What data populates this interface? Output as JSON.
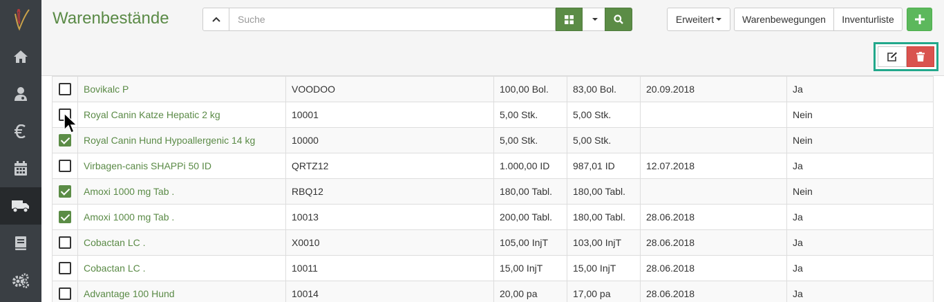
{
  "header": {
    "title": "Warenbestände",
    "search_placeholder": "Suche",
    "erweitert_label": "Erweitert",
    "warenbewegungen_label": "Warenbewegungen",
    "inventurliste_label": "Inventurliste"
  },
  "sidebar": {
    "items": [
      {
        "icon": "home-icon"
      },
      {
        "icon": "user-doctor-icon"
      },
      {
        "icon": "euro-icon"
      },
      {
        "icon": "calendar-icon"
      },
      {
        "icon": "truck-icon",
        "active": true
      },
      {
        "icon": "book-icon"
      },
      {
        "icon": "gears-icon"
      }
    ]
  },
  "colors": {
    "accent_green": "#5b8c46",
    "add_green": "#5cb85c",
    "delete_red": "#d9534f",
    "highlight_teal": "#22a88b",
    "sidebar_bg": "#3a3f44"
  },
  "table": {
    "rows": [
      {
        "checked": false,
        "name": "Bovikalc P",
        "code": "VOODOO",
        "qty1": "100,00 Bol.",
        "qty2": "83,00 Bol.",
        "date": "20.09.2018",
        "flag": "Ja"
      },
      {
        "checked": false,
        "name": "Royal Canin Katze Hepatic 2 kg",
        "code": "10001",
        "qty1": "5,00 Stk.",
        "qty2": "5,00 Stk.",
        "date": "",
        "flag": "Nein"
      },
      {
        "checked": true,
        "name": "Royal Canin Hund Hypoallergenic 14 kg",
        "code": "10000",
        "qty1": "5,00 Stk.",
        "qty2": "5,00 Stk.",
        "date": "",
        "flag": "Nein"
      },
      {
        "checked": false,
        "name": "Virbagen-canis SHAPPi 50 ID",
        "code": "QRTZ12",
        "qty1": "1.000,00 ID",
        "qty2": "987,01 ID",
        "date": "12.07.2018",
        "flag": "Ja"
      },
      {
        "checked": true,
        "name": "Amoxi 1000 mg Tab .",
        "code": "RBQ12",
        "qty1": "180,00 Tabl.",
        "qty2": "180,00 Tabl.",
        "date": "",
        "flag": "Nein"
      },
      {
        "checked": true,
        "name": "Amoxi 1000 mg Tab .",
        "code": "10013",
        "qty1": "200,00 Tabl.",
        "qty2": "180,00 Tabl.",
        "date": "28.06.2018",
        "flag": "Ja"
      },
      {
        "checked": false,
        "name": "Cobactan LC .",
        "code": "X0010",
        "qty1": "105,00 InjT",
        "qty2": "103,00 InjT",
        "date": "28.06.2018",
        "flag": "Ja"
      },
      {
        "checked": false,
        "name": "Cobactan LC .",
        "code": "10011",
        "qty1": "15,00 InjT",
        "qty2": "15,00 InjT",
        "date": "28.06.2018",
        "flag": "Ja"
      },
      {
        "checked": false,
        "name": "Advantage 100 Hund",
        "code": "10014",
        "qty1": "20,00 pa",
        "qty2": "17,00 pa",
        "date": "28.06.2018",
        "flag": "Ja"
      }
    ]
  }
}
